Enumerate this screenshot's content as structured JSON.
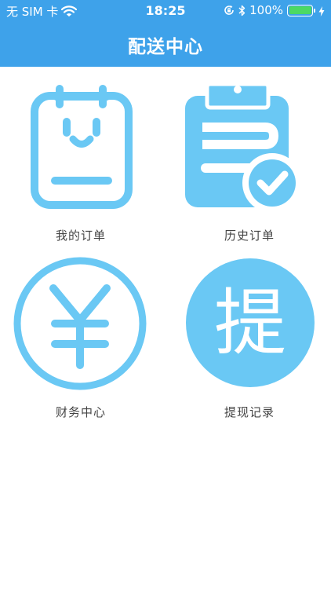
{
  "status_bar": {
    "carrier": "无 SIM 卡",
    "time": "18:25",
    "battery_percent": "100%",
    "battery_level": 1.0,
    "battery_color": "#4cd964",
    "icons": [
      "wifi-icon",
      "rotation-lock-icon",
      "bluetooth-icon",
      "battery-icon",
      "charging-icon"
    ]
  },
  "nav": {
    "title": "配送中心",
    "background": "#3ea2ea"
  },
  "menu": {
    "accent": "#6ac8f4",
    "items": [
      {
        "label": "我的订单",
        "icon": "clipboard-face-icon"
      },
      {
        "label": "历史订单",
        "icon": "clipboard-check-icon"
      },
      {
        "label": "财务中心",
        "icon": "yen-icon"
      },
      {
        "label": "提现记录",
        "icon": "withdraw-icon",
        "icon_text": "提"
      }
    ]
  }
}
